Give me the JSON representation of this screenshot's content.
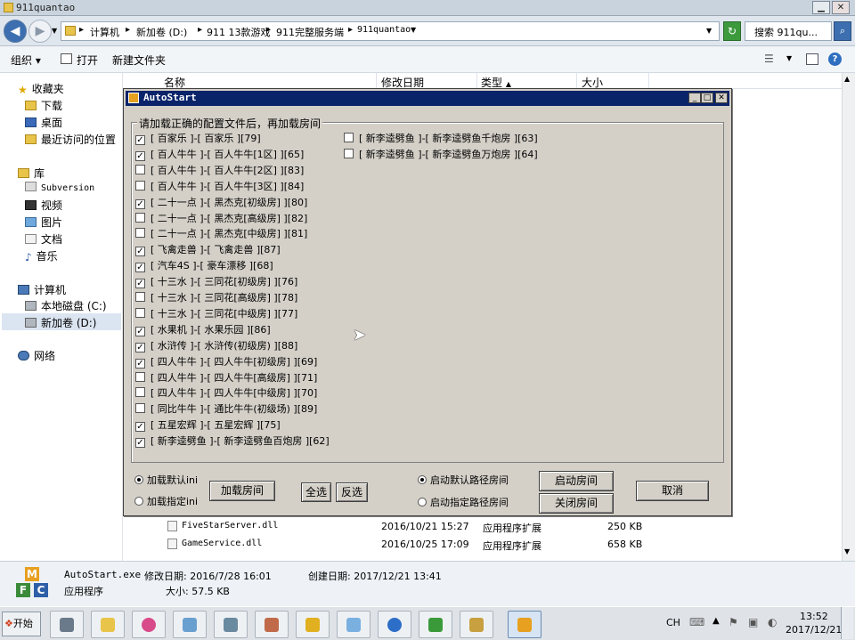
{
  "explorer": {
    "title": "911quantao",
    "breadcrumb": [
      "计算机",
      "新加卷 (D:)",
      "911 13款游戏",
      "911完整服务端",
      "911quantao"
    ],
    "search_placeholder": "搜索 911qu...",
    "toolbar": {
      "organize": "组织",
      "open": "打开",
      "new_folder": "新建文件夹"
    },
    "sidebar": {
      "favorites": "收藏夹",
      "fav_items": [
        "下载",
        "桌面",
        "最近访问的位置"
      ],
      "libraries": "库",
      "lib_items": [
        "Subversion",
        "视频",
        "图片",
        "文档",
        "音乐"
      ],
      "computer": "计算机",
      "comp_items": [
        "本地磁盘 (C:)",
        "新加卷 (D:)"
      ],
      "network": "网络"
    },
    "columns": {
      "name": "名称",
      "date": "修改日期",
      "type": "类型",
      "size": "大小"
    },
    "files": [
      {
        "name": "FiveStarServer.dll",
        "date": "2016/10/21 15:27",
        "type": "应用程序扩展",
        "size": "250 KB"
      },
      {
        "name": "GameService.dll",
        "date": "2016/10/25 17:09",
        "type": "应用程序扩展",
        "size": "658 KB"
      }
    ],
    "details": {
      "filename": "AutoStart.exe",
      "modified": "修改日期: 2016/7/28 16:01",
      "created": "创建日期: 2017/12/21 13:41",
      "kind": "应用程序",
      "size": "大小: 57.5 KB",
      "icon_text": [
        "M",
        "F",
        "C"
      ]
    }
  },
  "dialog": {
    "title": "AutoStart",
    "group_label": "请加载正确的配置文件后，再加载房间",
    "left_items": [
      {
        "label": "[ 百家乐 ]-[ 百家乐 ][79]",
        "checked": true
      },
      {
        "label": "[ 百人牛牛 ]-[ 百人牛牛[1区] ][65]",
        "checked": true
      },
      {
        "label": "[ 百人牛牛 ]-[ 百人牛牛[2区] ][83]",
        "checked": false
      },
      {
        "label": "[ 百人牛牛 ]-[ 百人牛牛[3区] ][84]",
        "checked": false
      },
      {
        "label": "[ 二十一点 ]-[ 黑杰克[初级房] ][80]",
        "checked": true
      },
      {
        "label": "[ 二十一点 ]-[ 黑杰克[高级房] ][82]",
        "checked": false
      },
      {
        "label": "[ 二十一点 ]-[ 黑杰克[中级房] ][81]",
        "checked": false
      },
      {
        "label": "[ 飞禽走兽 ]-[ 飞禽走兽 ][87]",
        "checked": true
      },
      {
        "label": "[ 汽车4S ]-[ 豪车漂移 ][68]",
        "checked": true
      },
      {
        "label": "[ 十三水 ]-[ 三同花[初级房] ][76]",
        "checked": true
      },
      {
        "label": "[ 十三水 ]-[ 三同花[高级房] ][78]",
        "checked": false
      },
      {
        "label": "[ 十三水 ]-[ 三同花[中级房] ][77]",
        "checked": false
      },
      {
        "label": "[ 水果机 ]-[ 水果乐园 ][86]",
        "checked": true
      },
      {
        "label": "[ 水浒传 ]-[ 水浒传(初级房) ][88]",
        "checked": true
      },
      {
        "label": "[ 四人牛牛 ]-[ 四人牛牛[初级房] ][69]",
        "checked": true
      },
      {
        "label": "[ 四人牛牛 ]-[ 四人牛牛[高级房] ][71]",
        "checked": false
      },
      {
        "label": "[ 四人牛牛 ]-[ 四人牛牛[中级房] ][70]",
        "checked": false
      },
      {
        "label": "[ 同比牛牛 ]-[ 通比牛牛(初级场) ][89]",
        "checked": false
      },
      {
        "label": "[ 五星宏辉 ]-[ 五星宏辉 ][75]",
        "checked": true
      },
      {
        "label": "[ 新李逵劈鱼 ]-[ 新李逵劈鱼百炮房 ][62]",
        "checked": true
      }
    ],
    "right_items": [
      {
        "label": "[ 新李逵劈鱼 ]-[ 新李逵劈鱼千炮房 ][63]",
        "checked": false
      },
      {
        "label": "[ 新李逵劈鱼 ]-[ 新李逵劈鱼万炮房 ][64]",
        "checked": false
      }
    ],
    "radio_default": "加载默认ini",
    "radio_specify": "加载指定ini",
    "btn_load_room": "加载房间",
    "btn_select_all": "全选",
    "btn_invert": "反选",
    "radio_path_default": "启动默认路径房间",
    "radio_path_specify": "启动指定路径房间",
    "btn_start": "启动房间",
    "btn_close_room": "关闭房间",
    "btn_cancel": "取消"
  },
  "taskbar": {
    "start": "开始",
    "ime": "CH",
    "time": "13:52",
    "date": "2017/12/21"
  }
}
